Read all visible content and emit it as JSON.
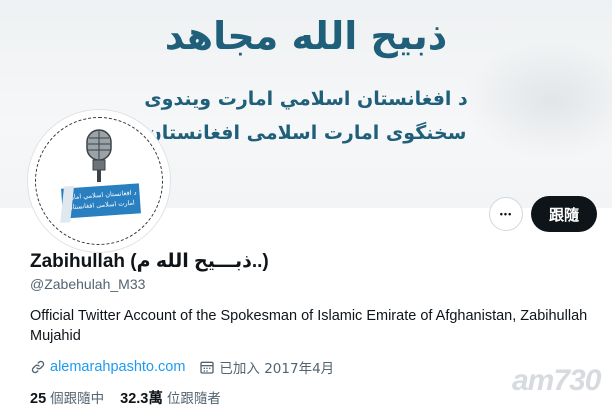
{
  "banner": {
    "title": "ذبيح الله مجاهد",
    "line1": "د افغانستان اسلامي امارت ويندوى",
    "line2": "سخنگوی امارت اسلامی افغانستان"
  },
  "avatar": {
    "flag_line1": "د افغانستان اسلامي امارت",
    "flag_line2": "امارت اسلامی افغانستان"
  },
  "actions": {
    "more_label": "•••",
    "follow_label": "跟隨"
  },
  "profile": {
    "name": "Zabihullah (ذبـــيح الله م..)",
    "handle": "@Zabehulah_M33",
    "bio": "Official Twitter Account of the Spokesman of Islamic Emirate of Afghanistan, Zabihullah Mujahid",
    "website": "alemarahpashto.com",
    "joined": "已加入 2017年4月"
  },
  "stats": {
    "following_count": "25",
    "following_label": "個跟隨中",
    "followers_count": "32.3萬",
    "followers_label": "位跟隨者"
  },
  "watermark": "am730",
  "colors": {
    "banner_text": "#1f5f7a",
    "link": "#1d9bf0",
    "secondary_text": "#536471",
    "primary_text": "#0f1419",
    "follow_bg": "#0f1419"
  }
}
